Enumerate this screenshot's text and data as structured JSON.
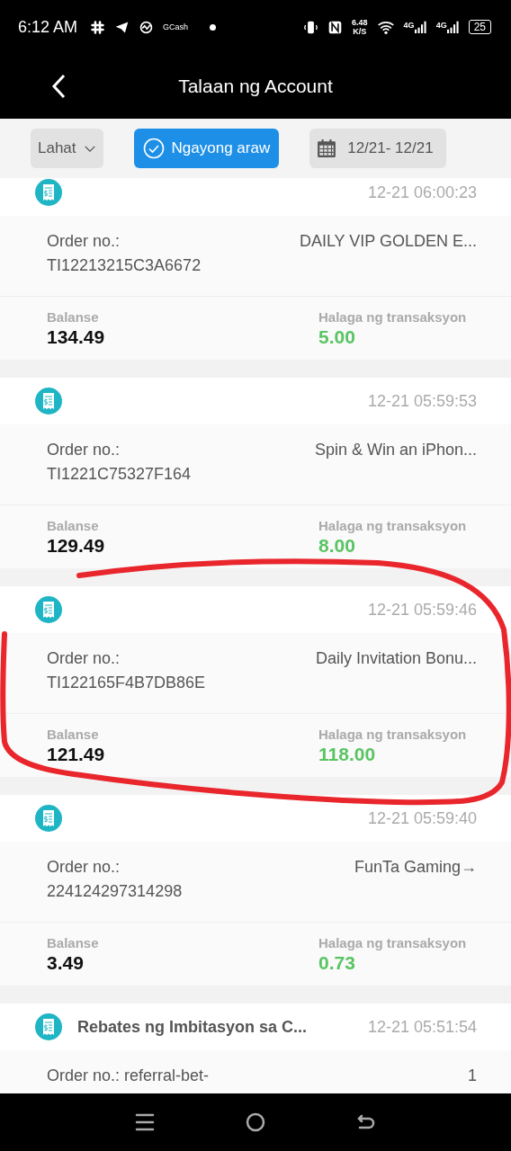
{
  "status_bar": {
    "time": "6:12 AM",
    "app_label": "GCash",
    "net_speed": "6.48",
    "net_unit": "K/S",
    "signals": [
      {
        "label": "4G"
      },
      {
        "label": "4G"
      }
    ],
    "battery": "25"
  },
  "header": {
    "title": "Talaan ng Account"
  },
  "filters": [
    {
      "kind": "dropdown",
      "label": "Lahat",
      "selected": false
    },
    {
      "kind": "toggle",
      "label": "Ngayong araw",
      "selected": true
    },
    {
      "kind": "date",
      "label": "12/21- 12/21",
      "selected": false
    }
  ],
  "transactions": [
    {
      "kind": "stacked",
      "time": "12-21 06:00:23",
      "order_label": "Order no.:",
      "order_no": "TI12213215C3A6672",
      "description": "DAILY VIP GOLDEN E...",
      "balance_label": "Balanse",
      "balance": "134.49",
      "amount_label": "Halaga ng transaksyon",
      "amount": "5.00"
    },
    {
      "kind": "stacked",
      "time": "12-21 05:59:53",
      "order_label": "Order no.:",
      "order_no": "TI1221C75327F164",
      "description": "Spin & Win an iPhon...",
      "balance_label": "Balanse",
      "balance": "129.49",
      "amount_label": "Halaga ng transaksyon",
      "amount": "8.00"
    },
    {
      "kind": "stacked",
      "time": "12-21 05:59:46",
      "order_label": "Order no.:",
      "order_no": "TI122165F4B7DB86E",
      "description": "Daily Invitation Bonu...",
      "balance_label": "Balanse",
      "balance": "121.49",
      "amount_label": "Halaga ng transaksyon",
      "amount": "118.00"
    },
    {
      "kind": "stacked",
      "time": "12-21 05:59:40",
      "order_label": "Order no.:",
      "order_no": "224124297314298",
      "description": "FunTa Gaming→",
      "balance_label": "Balanse",
      "balance": "3.49",
      "amount_label": "Halaga ng transaksyon",
      "amount": "0.73"
    },
    {
      "kind": "inline",
      "title": "Rebates ng Imbitasyon sa C...",
      "time": "12-21 05:51:54",
      "order_label": "Order no.:",
      "order_no": "referral-bet-",
      "description": "1"
    }
  ]
}
